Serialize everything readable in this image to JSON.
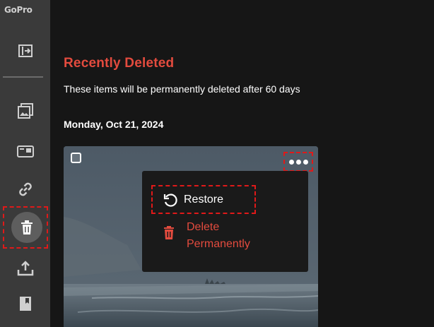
{
  "sidebar": {
    "logo": "GoPro",
    "items": [
      {
        "icon": "collapse-sidebar-icon"
      },
      {
        "icon": "media-library-icon"
      },
      {
        "icon": "camera-icon"
      },
      {
        "icon": "link-icon"
      },
      {
        "icon": "trash-icon"
      },
      {
        "icon": "upload-icon"
      },
      {
        "icon": "bookmark-book-icon"
      }
    ]
  },
  "main": {
    "title": "Recently Deleted",
    "subtitle": "These items will be permanently deleted after 60 days",
    "date_heading": "Monday, Oct 21, 2024"
  },
  "context_menu": {
    "restore_label": "Restore",
    "delete_label": "Delete Permanently"
  },
  "colors": {
    "accent": "#e34b3e",
    "highlight": "#e01919",
    "sidebar_bg": "#3a3a3a",
    "page_bg": "#161616"
  }
}
